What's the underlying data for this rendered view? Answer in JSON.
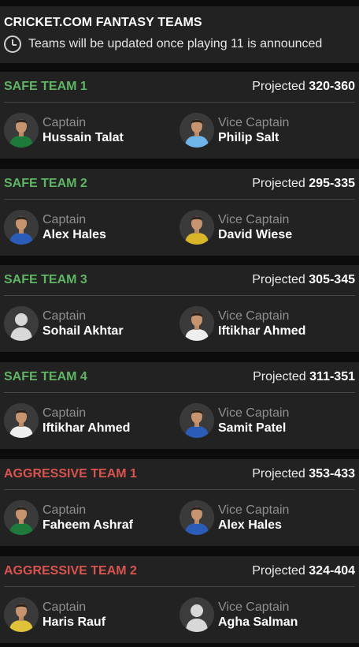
{
  "header": {
    "title": "CRICKET.COM FANTASY TEAMS",
    "note": "Teams will be updated once playing 11 is announced",
    "icon": "clock-icon"
  },
  "colors": {
    "safe": "#5eb563",
    "aggressive": "#d9534f",
    "card": "#222222",
    "background": "#0c0c0c"
  },
  "teams": [
    {
      "name": "SAFE TEAM 1",
      "kind": "safe",
      "projected_label": "Projected",
      "projected": "320-360",
      "captain": {
        "role": "Captain",
        "name": "Hussain Talat",
        "jersey": "#1e7a3a"
      },
      "vice": {
        "role": "Vice Captain",
        "name": "Philip Salt",
        "jersey": "#6fb4e8"
      }
    },
    {
      "name": "SAFE TEAM 2",
      "kind": "safe",
      "projected_label": "Projected",
      "projected": "295-335",
      "captain": {
        "role": "Captain",
        "name": "Alex Hales",
        "jersey": "#2a5cb8"
      },
      "vice": {
        "role": "Vice Captain",
        "name": "David Wiese",
        "jersey": "#d9b52a"
      }
    },
    {
      "name": "SAFE TEAM 3",
      "kind": "safe",
      "projected_label": "Projected",
      "projected": "305-345",
      "captain": {
        "role": "Captain",
        "name": "Sohail Akhtar",
        "jersey": "placeholder"
      },
      "vice": {
        "role": "Vice Captain",
        "name": "Iftikhar Ahmed",
        "jersey": "#eeeeee"
      }
    },
    {
      "name": "SAFE TEAM 4",
      "kind": "safe",
      "projected_label": "Projected",
      "projected": "311-351",
      "captain": {
        "role": "Captain",
        "name": "Iftikhar Ahmed",
        "jersey": "#eeeeee"
      },
      "vice": {
        "role": "Vice Captain",
        "name": "Samit Patel",
        "jersey": "#2a5cb8"
      }
    },
    {
      "name": "AGGRESSIVE TEAM 1",
      "kind": "aggr",
      "projected_label": "Projected",
      "projected": "353-433",
      "captain": {
        "role": "Captain",
        "name": "Faheem Ashraf",
        "jersey": "#1e7a3a"
      },
      "vice": {
        "role": "Vice Captain",
        "name": "Alex Hales",
        "jersey": "#2a5cb8"
      }
    },
    {
      "name": "AGGRESSIVE TEAM 2",
      "kind": "aggr",
      "projected_label": "Projected",
      "projected": "324-404",
      "captain": {
        "role": "Captain",
        "name": "Haris Rauf",
        "jersey": "#e0c23a"
      },
      "vice": {
        "role": "Vice Captain",
        "name": "Agha Salman",
        "jersey": "placeholder"
      }
    }
  ]
}
